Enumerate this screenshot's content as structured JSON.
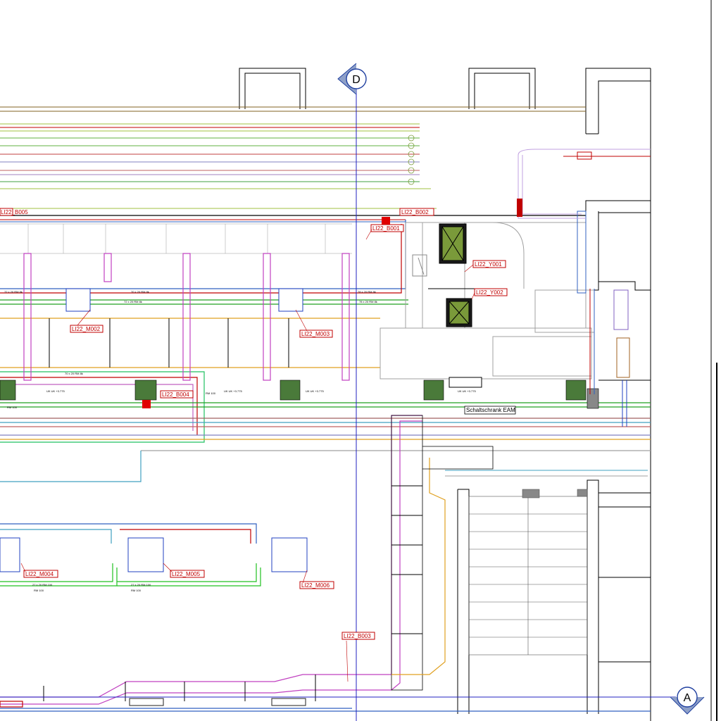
{
  "drawing": {
    "axis_markers": {
      "top": "D",
      "bottom_right": "A"
    },
    "tags": [
      {
        "id": "LI22_B005",
        "label": "LI22_B005"
      },
      {
        "id": "LI22_B002",
        "label": "LI22_B002"
      },
      {
        "id": "LI22_B001",
        "label": "LI22_B001"
      },
      {
        "id": "LI22_Y001",
        "label": "LI22_Y001"
      },
      {
        "id": "LI22_Y002",
        "label": "LI22_Y002"
      },
      {
        "id": "LI22_M002",
        "label": "LI22_M002"
      },
      {
        "id": "LI22_M003",
        "label": "LI22_M003"
      },
      {
        "id": "LI22_B004",
        "label": "LI22_B004"
      },
      {
        "id": "LI22_M004",
        "label": "LI22_M004"
      },
      {
        "id": "LI22_M005",
        "label": "LI22_M005"
      },
      {
        "id": "LI22_M006",
        "label": "LI22_M006"
      },
      {
        "id": "LI22_B003",
        "label": "LI22_B003"
      }
    ],
    "cabinet_label": "Schaltschrank EAM",
    "duct_labels": {
      "a": "70 x 20  RM 8k",
      "b": "72 x 20  RM 8k",
      "c": "78 x 20  RM 8k",
      "d": "78 x 20  RM 8k",
      "e": "UK UK  +3.775",
      "f": "UK UK  +3.775",
      "g": "UK UK  +3.775",
      "h": "UK UK  +3.775",
      "i": "70 x 20  RM 8k",
      "j": "72 x 20  RM 8k",
      "k": "RM 100",
      "l": "RM 100",
      "m": "27 x 20  RM 100",
      "n": "27 x 20  RM 100",
      "o": "RM 100",
      "p": "RM 100"
    }
  }
}
